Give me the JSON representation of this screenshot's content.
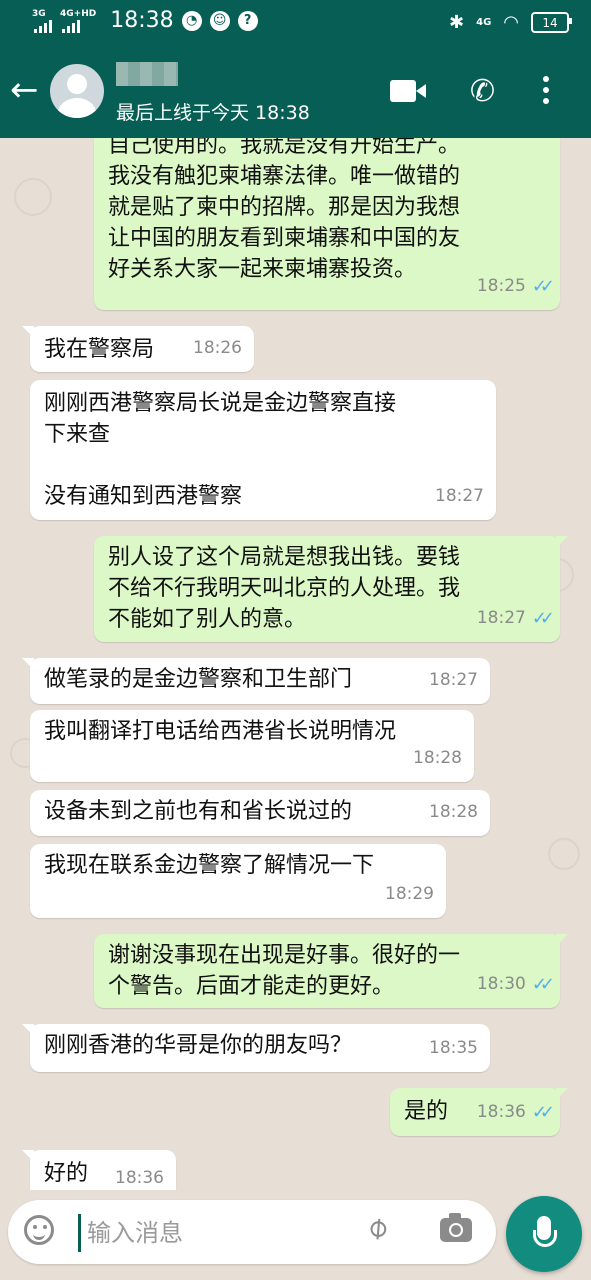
{
  "status_bar": {
    "signal_1": "3G",
    "signal_2": "4G+HD",
    "time": "18:38",
    "network": "4G",
    "battery": "14"
  },
  "header": {
    "contact_name": "",
    "last_seen": "最后上线于今天 18:38"
  },
  "messages": [
    {
      "dir": "out",
      "text": "自己使用的。我就是没有开始生产。\n我没有触犯柬埔寨法律。唯一做错的\n就是贴了柬中的招牌。那是因为我想\n让中国的朋友看到柬埔寨和中国的友\n好关系大家一起来柬埔寨投资。",
      "time": "18:25"
    },
    {
      "dir": "in",
      "text": "我在警察局",
      "time": "18:26"
    },
    {
      "dir": "in",
      "text": "刚刚西港警察局长说是金边警察直接\n下来查\n\n没有通知到西港警察",
      "time": "18:27"
    },
    {
      "dir": "out",
      "text": "别人设了这个局就是想我出钱。要钱\n不给不行我明天叫北京的人处理。我\n不能如了别人的意。",
      "time": "18:27"
    },
    {
      "dir": "in",
      "text": "做笔录的是金边警察和卫生部门",
      "time": "18:27"
    },
    {
      "dir": "in",
      "text": "我叫翻译打电话给西港省长说明情况",
      "time": "18:28"
    },
    {
      "dir": "in",
      "text": "设备未到之前也有和省长说过的",
      "time": "18:28"
    },
    {
      "dir": "in",
      "text": "我现在联系金边警察了解情况一下",
      "time": "18:29"
    },
    {
      "dir": "out",
      "text": "谢谢没事现在出现是好事。很好的一\n个警告。后面才能走的更好。",
      "time": "18:30"
    },
    {
      "dir": "in",
      "text": "刚刚香港的华哥是你的朋友吗？",
      "time": "18:35"
    },
    {
      "dir": "out",
      "text": "是的",
      "time": "18:36"
    },
    {
      "dir": "in",
      "text": "好的",
      "time": "18:36"
    }
  ],
  "input": {
    "placeholder": "输入消息"
  },
  "colors": {
    "header": "#075e54",
    "incoming_bubble": "#ffffff",
    "outgoing_bubble": "#dcf8c6",
    "read_ticks": "#4fb0f0",
    "mic_button": "#128c7e",
    "wallpaper": "#e7ded5"
  },
  "icons": {
    "back": "arrow-left-icon",
    "video": "video-camera-icon",
    "call": "phone-icon",
    "menu": "more-vert-icon",
    "emoji": "emoji-icon",
    "attach": "paperclip-icon",
    "camera": "camera-icon",
    "mic": "mic-icon"
  }
}
